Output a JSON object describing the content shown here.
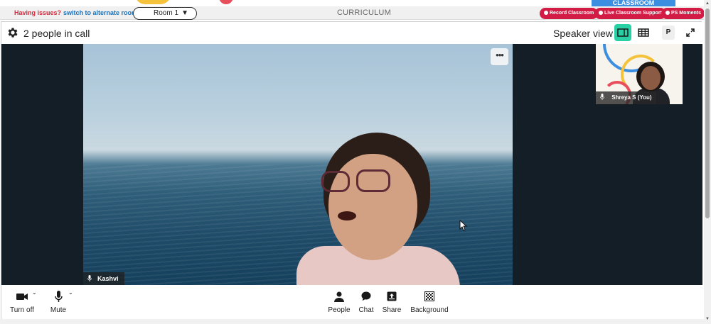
{
  "topbar": {
    "issues_text": "Having issues?",
    "alternate_link": "switch to alternate room",
    "room_selected": "Room 1",
    "section_title": "CURRICULUM",
    "banner": "CLASSROOM",
    "record_label": "Record Classroom",
    "support_label": "Live Classroom Support",
    "moments_label": "PS Moments"
  },
  "call": {
    "people_count": "2 people in call",
    "view_label": "Speaker view",
    "p_badge": "P"
  },
  "participants": {
    "main_name": "Kashvi",
    "thumb_name": "Shreya S (You)"
  },
  "toolbar": {
    "camera_label": "Turn off",
    "mute_label": "Mute",
    "people_label": "People",
    "chat_label": "Chat",
    "share_label": "Share",
    "background_label": "Background"
  },
  "colors": {
    "accent_green": "#29d0a4",
    "brand_red": "#d21c45",
    "stage_bg": "#131e27"
  }
}
